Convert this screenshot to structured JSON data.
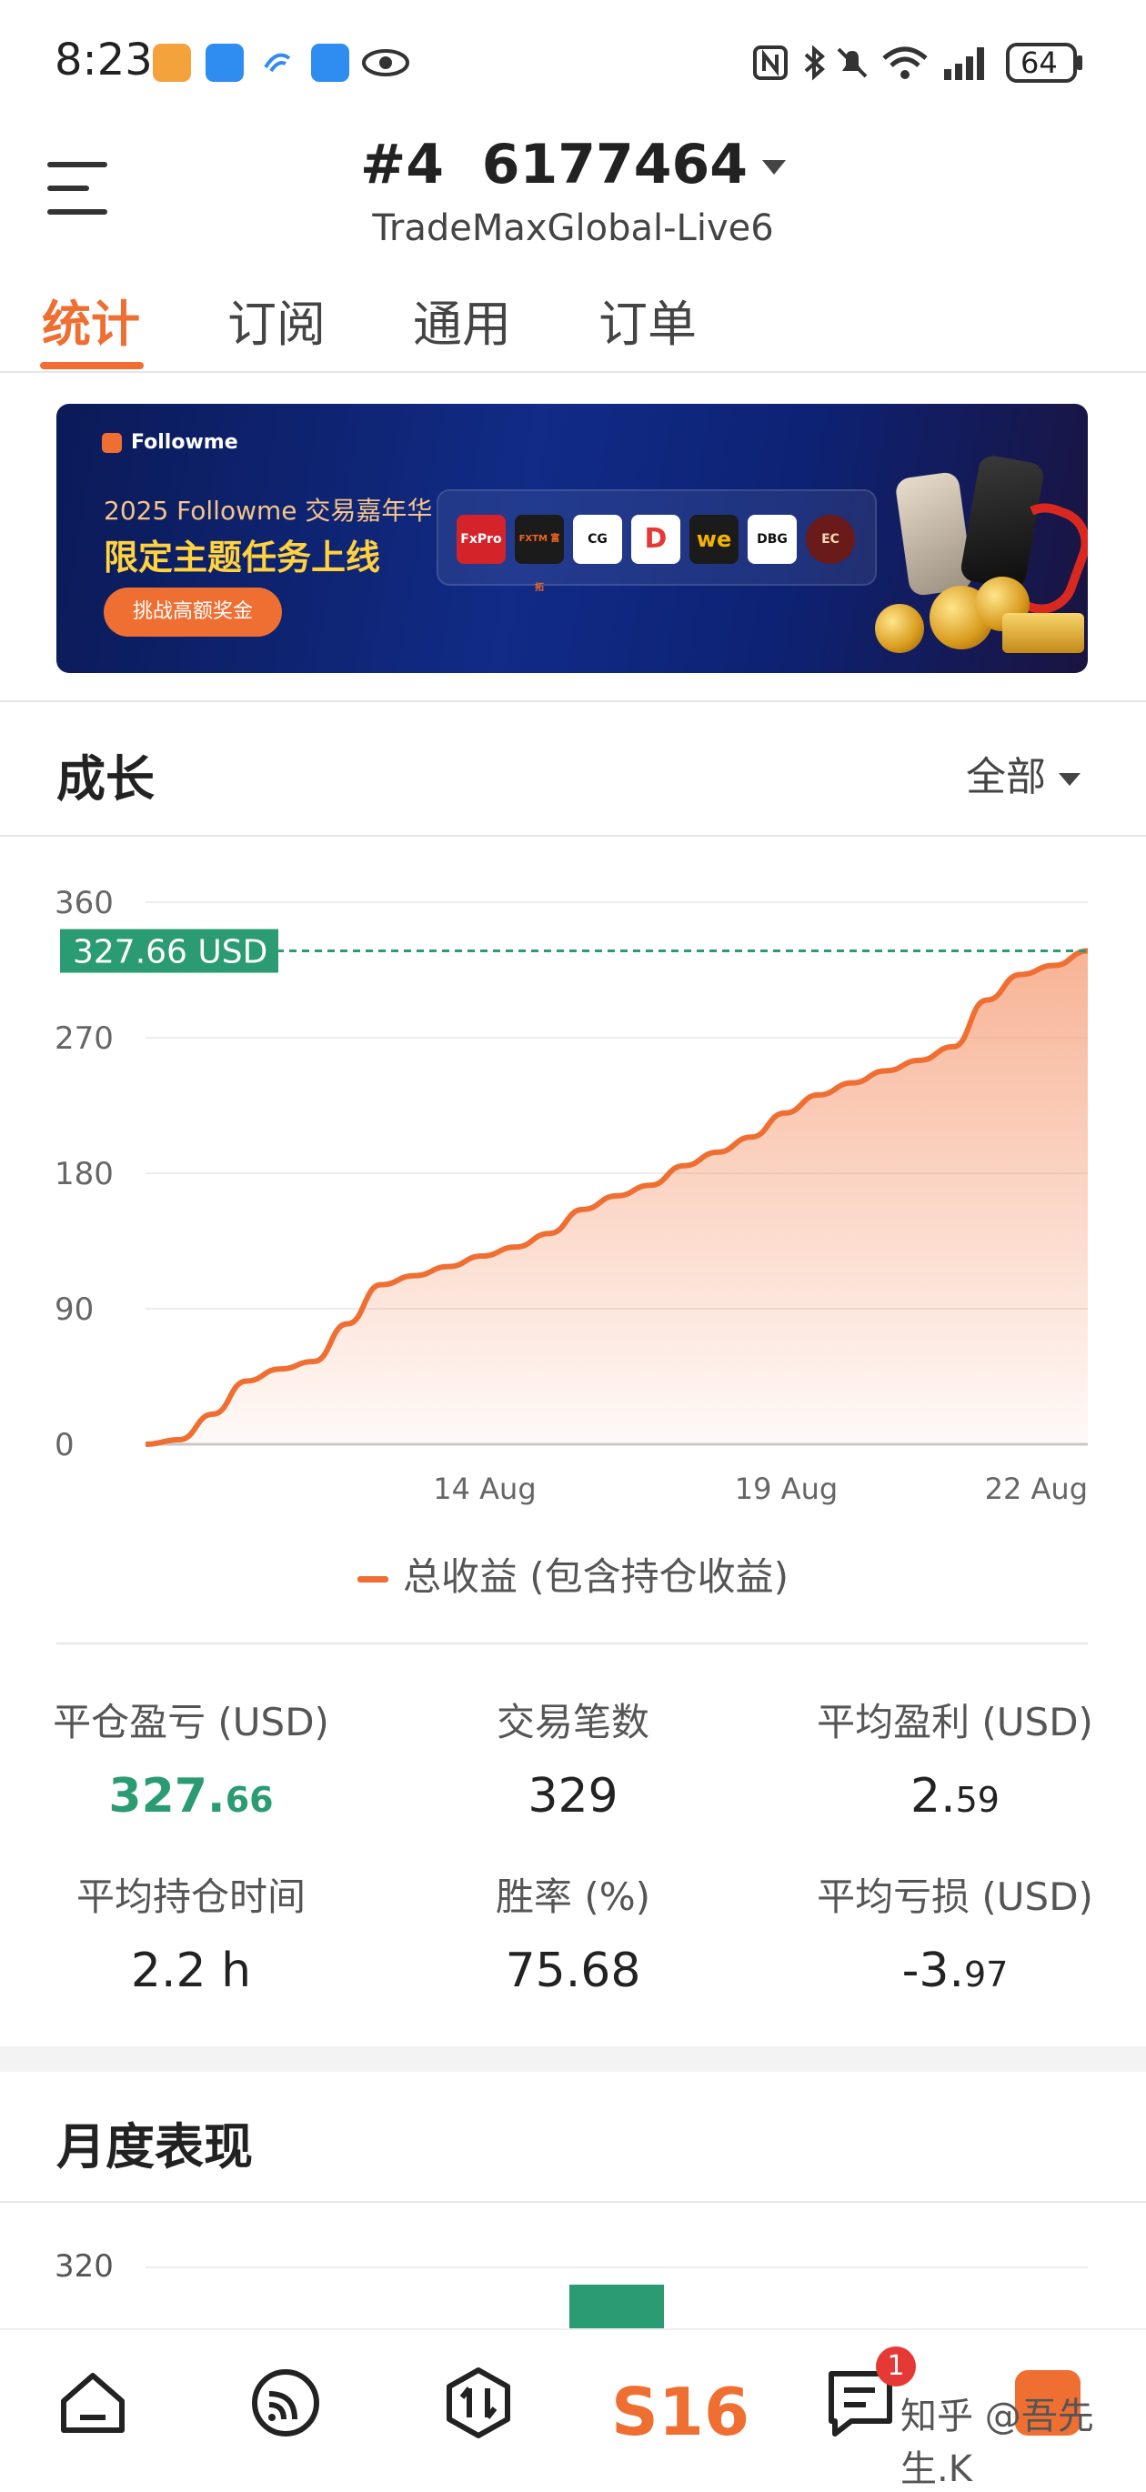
{
  "status_bar": {
    "time": "8:23",
    "battery": "64"
  },
  "header": {
    "account_number": "#4  6177464",
    "server": "TradeMaxGlobal-Live6"
  },
  "tabs": [
    {
      "label": "统计",
      "active": true
    },
    {
      "label": "订阅",
      "active": false
    },
    {
      "label": "通用",
      "active": false
    },
    {
      "label": "订单",
      "active": false
    }
  ],
  "banner": {
    "brand": "Followme",
    "subtitle": "2025 Followme 交易嘉年华",
    "title": "限定主题任务上线",
    "button": "挑战高额奖金",
    "partner_logos": [
      "FxPro",
      "FXTM 富拓",
      "CG",
      "D",
      "we",
      "DBG",
      "EC"
    ]
  },
  "growth": {
    "title": "成长",
    "filter": "全部",
    "legend": "总收益 (包含持仓收益)"
  },
  "chart_data": {
    "type": "area",
    "title": "成长",
    "y_ticks": [
      "360",
      "270",
      "180",
      "90",
      "0"
    ],
    "x_ticks": [
      "14 Aug",
      "19 Aug",
      "22 Aug"
    ],
    "ylim": [
      0,
      360
    ],
    "current_value_label": "327.66 USD",
    "current_value": 327.66,
    "series": [
      {
        "name": "总收益 (包含持仓收益)",
        "color": "#ef6f33",
        "values": [
          0,
          3,
          20,
          42,
          50,
          55,
          80,
          106,
          112,
          118,
          125,
          131,
          140,
          156,
          165,
          172,
          185,
          194,
          204,
          220,
          232,
          240,
          248,
          255,
          264,
          295,
          312,
          318,
          327.66
        ]
      }
    ]
  },
  "stats": [
    {
      "label": "平仓盈亏 (USD)",
      "int": "327.",
      "dec": "66",
      "color": "green"
    },
    {
      "label": "交易笔数",
      "int": "329",
      "dec": "",
      "color": "default"
    },
    {
      "label": "平均盈利 (USD)",
      "int": "2.",
      "dec": "59",
      "color": "default"
    },
    {
      "label": "平均持仓时间",
      "int": "2.2 h",
      "dec": "",
      "color": "default"
    },
    {
      "label": "胜率 (%)",
      "int": "75.68",
      "dec": "",
      "color": "default"
    },
    {
      "label": "平均亏损 (USD)",
      "int": "-3.",
      "dec": "97",
      "color": "default"
    }
  ],
  "monthly": {
    "title": "月度表现",
    "y_top": "320"
  },
  "bottom_nav": {
    "badge": "1",
    "center_label": "S16",
    "watermark": "知乎 @吾先生.K"
  }
}
